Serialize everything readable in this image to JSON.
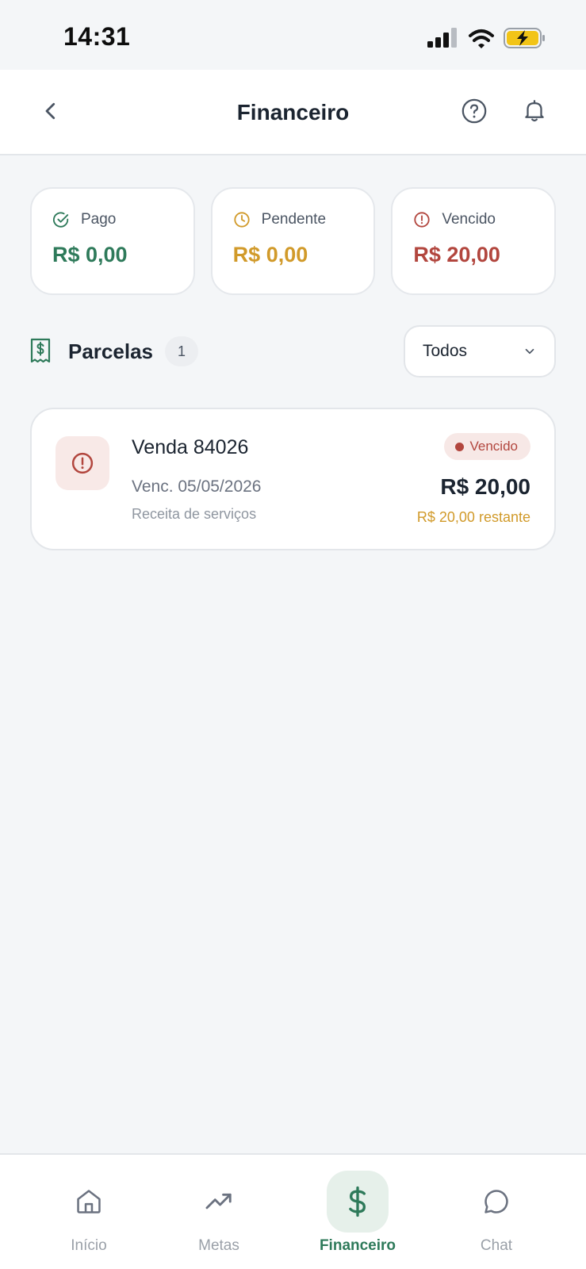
{
  "status_bar": {
    "time": "14:31"
  },
  "header": {
    "title": "Financeiro"
  },
  "summary": [
    {
      "label": "Pago",
      "value": "R$ 0,00",
      "color": "#2e7a5a",
      "icon": "check-circle-icon"
    },
    {
      "label": "Pendente",
      "value": "R$ 0,00",
      "color": "#d19a2a",
      "icon": "clock-icon"
    },
    {
      "label": "Vencido",
      "value": "R$ 20,00",
      "color": "#b2463e",
      "icon": "alert-circle-icon"
    }
  ],
  "parcelas": {
    "title": "Parcelas",
    "count": "1",
    "filter": "Todos",
    "items": [
      {
        "name": "Venda 84026",
        "due": "Venc. 05/05/2026",
        "category": "Receita de serviços",
        "status": "Vencido",
        "amount": "R$ 20,00",
        "remaining": "R$ 20,00 restante"
      }
    ]
  },
  "bottom_nav": [
    {
      "label": "Início",
      "icon": "home-icon",
      "active": false
    },
    {
      "label": "Metas",
      "icon": "trending-up-icon",
      "active": false
    },
    {
      "label": "Financeiro",
      "icon": "dollar-icon",
      "active": true
    },
    {
      "label": "Chat",
      "icon": "chat-bubble-icon",
      "active": false
    }
  ],
  "colors": {
    "accent": "#2e7a5a",
    "warning": "#d19a2a",
    "danger": "#b2463e",
    "background": "#f4f6f8"
  }
}
